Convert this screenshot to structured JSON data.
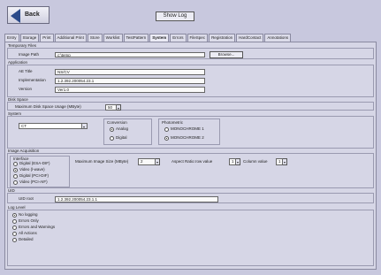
{
  "toolbar": {
    "back_label": "Back",
    "show_log_label": "Show Log"
  },
  "tabs": [
    "Entry",
    "Storage",
    "Print",
    "Additional Print",
    "Store",
    "Worklist",
    "TestPattern",
    "System",
    "Errors",
    "FileSpec",
    "Registration",
    "HardContact",
    "Annotations"
  ],
  "temporary_files": {
    "title": "Temporary Files",
    "image_path_label": "Image Path",
    "image_path_value": "c:\\temp",
    "browse_label": "Browse..."
  },
  "application": {
    "title": "Application",
    "ae_title_label": "AE Title",
    "ae_title_value": "NS/CV",
    "implementation_label": "Implementation",
    "implementation_value": "1.2.392.200054.23.1",
    "version_label": "Version",
    "version_value": "Ver1.0"
  },
  "disk_space": {
    "title": "Disk Space",
    "max_label": "Maximum Disk Space Usage (MByte)",
    "max_value": "50"
  },
  "system": {
    "title": "System",
    "select_value": "CT"
  },
  "conversion": {
    "title": "Conversion",
    "options": [
      "Analog",
      "Digital"
    ],
    "selected": 0
  },
  "photometric": {
    "title": "Photometric",
    "options": [
      "MONOCHROME 1",
      "MONOCHROME 2"
    ],
    "selected": 1
  },
  "image_acq": {
    "title": "Image Acquisition",
    "interface_label": "Interface",
    "options": [
      "Digital (ESA-DIF)",
      "Video (l-wave)",
      "Digital (PCI-DIF)",
      "Video (PCI-AIF)"
    ],
    "selected": 1,
    "max_label": "Maximum Image Size (MByte)",
    "max_value": "2",
    "aspect_label": "Aspect Ratio:",
    "row_label": "row value",
    "row_value": "1",
    "col_label": "Column value",
    "col_value": "1"
  },
  "uid": {
    "title": "UID",
    "root_label": "UID root",
    "root_value": "1.2.392.200054.23.1.1"
  },
  "log_level": {
    "title": "Log Level",
    "options": [
      "No logging",
      "Errors Only",
      "Errors and Warnings",
      "All Actions",
      "Detailed"
    ],
    "selected": 0
  }
}
